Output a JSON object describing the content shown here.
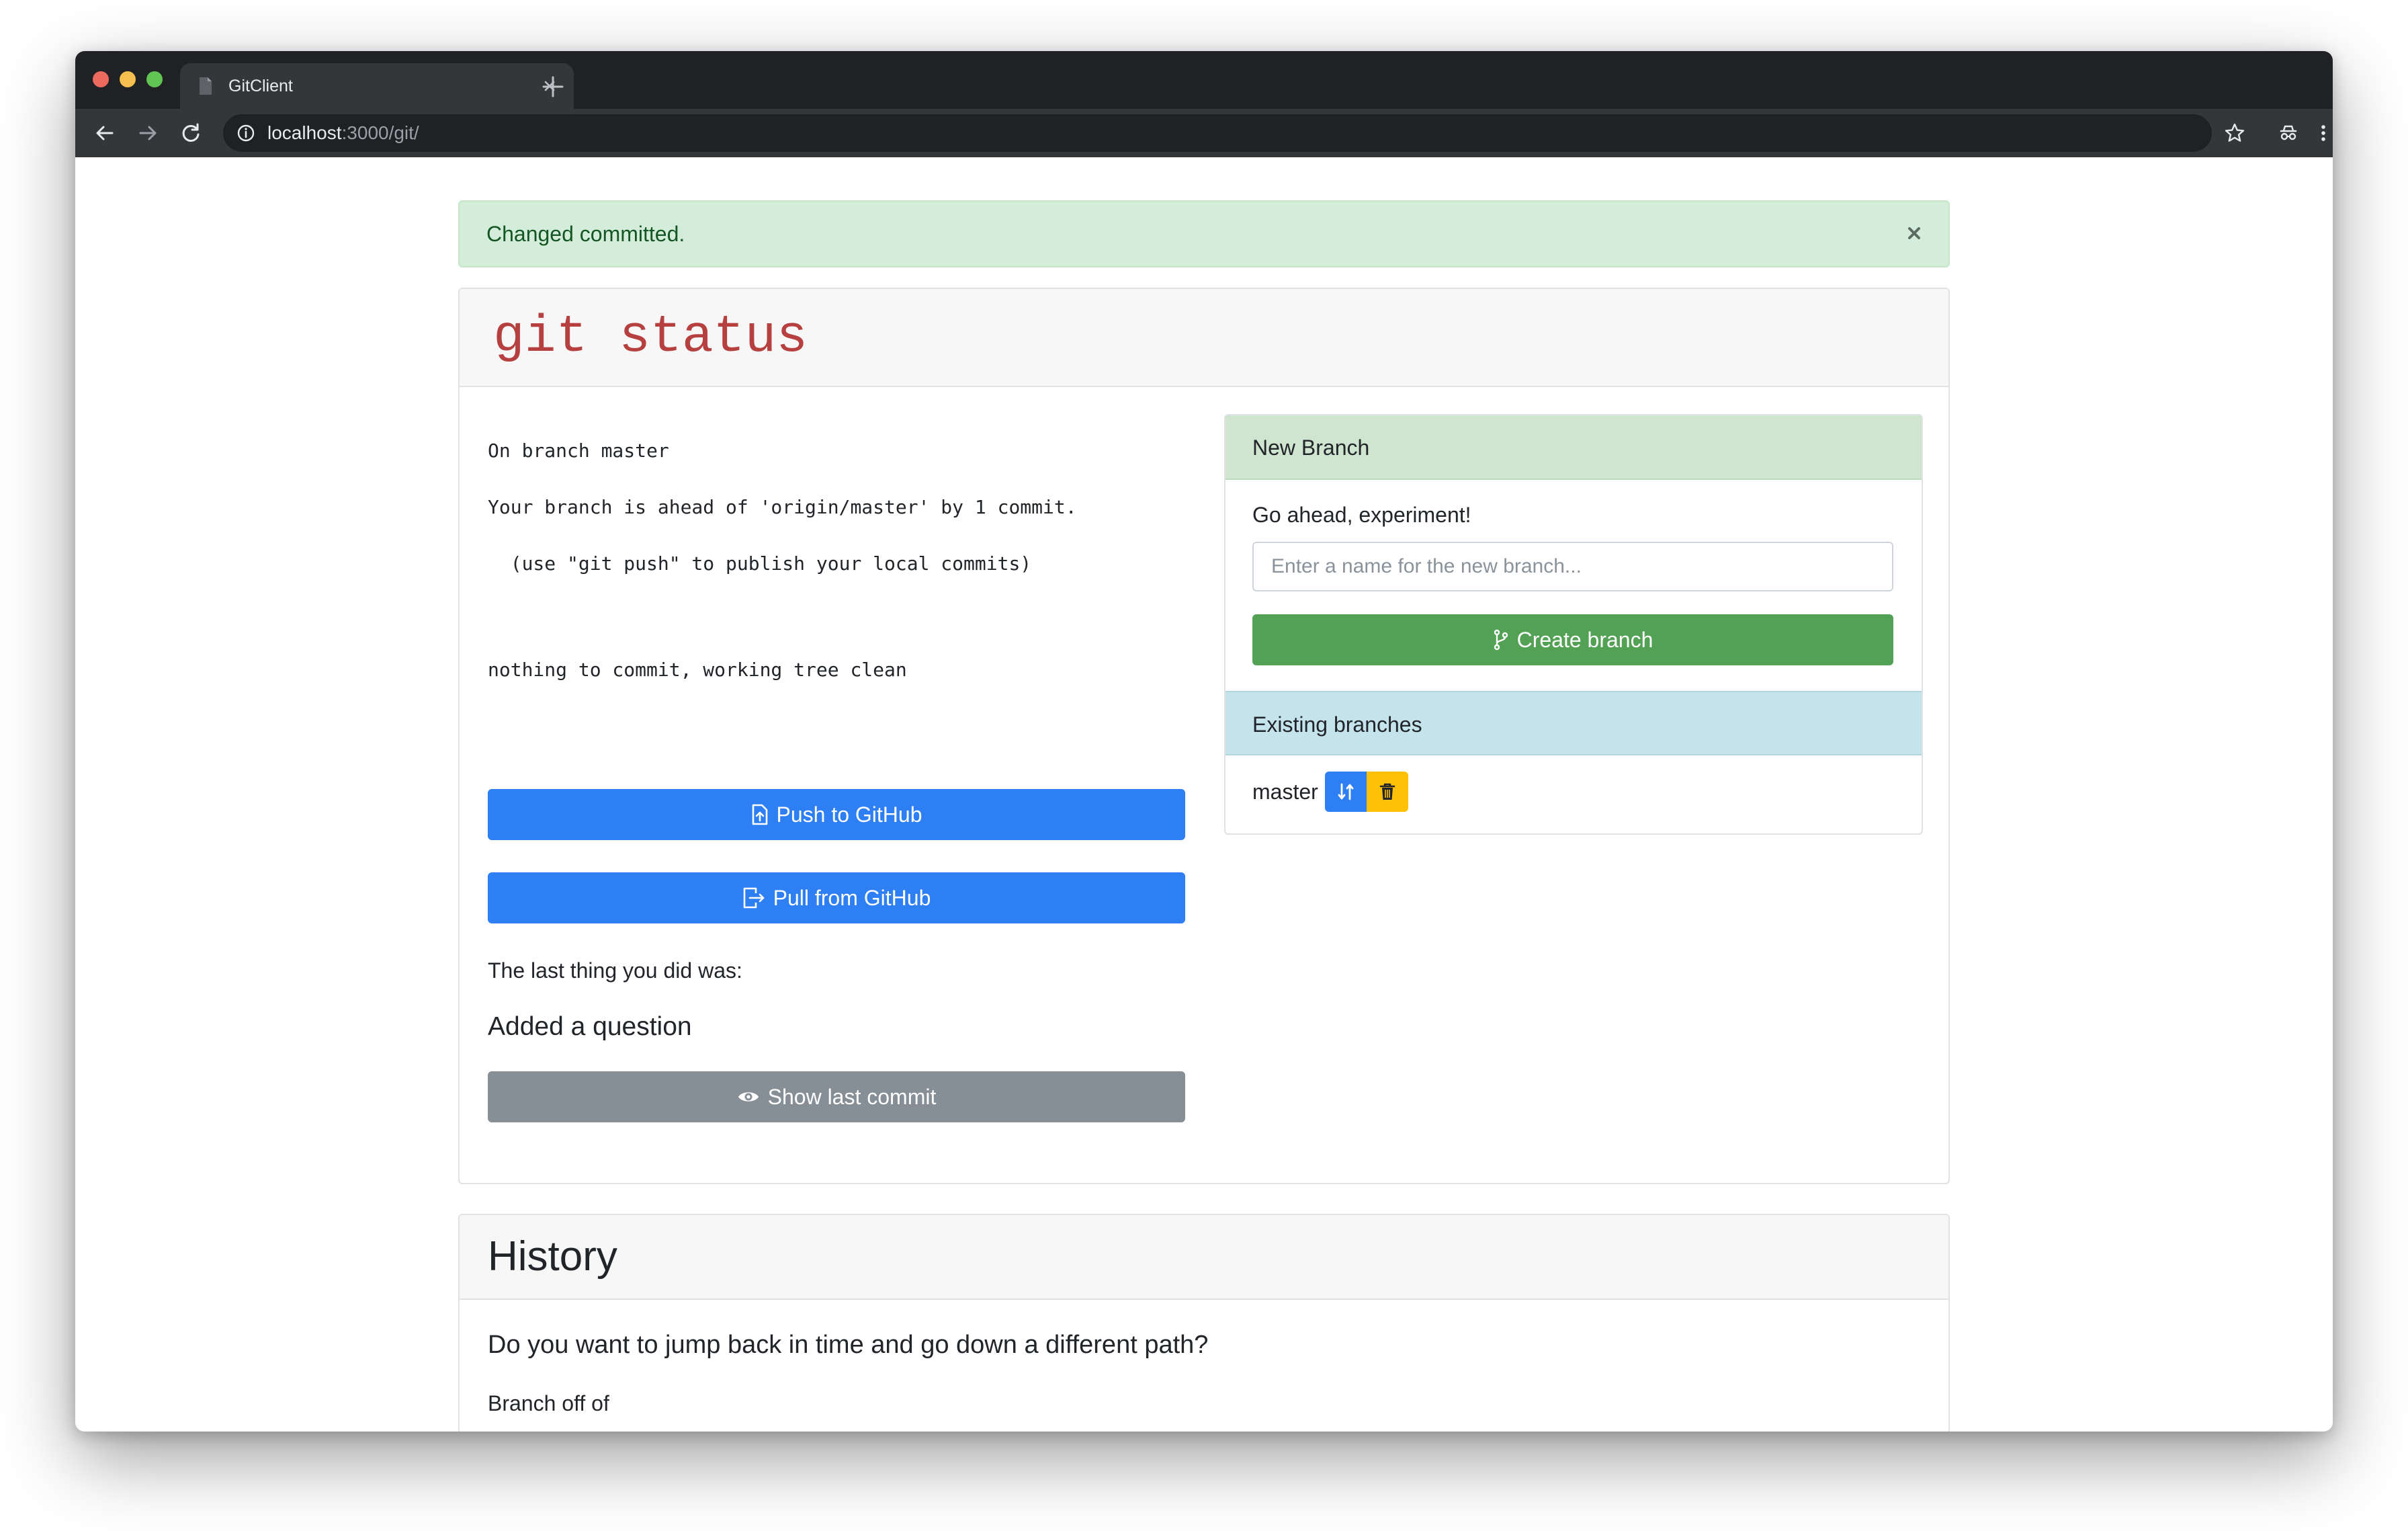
{
  "browser": {
    "tab_title": "GitClient",
    "url_host": "localhost",
    "url_path": ":3000/git/"
  },
  "alert": {
    "message": "Changed committed."
  },
  "status_card": {
    "title": "git status",
    "output": [
      "On branch master",
      "Your branch is ahead of 'origin/master' by 1 commit.",
      "  (use \"git push\" to publish your local commits)",
      "nothing to commit, working tree clean"
    ],
    "push_label": "Push to GitHub",
    "pull_label": "Pull from GitHub",
    "last_thing_label": "The last thing you did was:",
    "last_commit_message": "Added a question",
    "show_last_commit_label": "Show last commit"
  },
  "new_branch": {
    "header": "New Branch",
    "prompt": "Go ahead, experiment!",
    "input_placeholder": "Enter a name for the new branch...",
    "create_label": "Create branch"
  },
  "existing_branches": {
    "header": "Existing branches",
    "branches": [
      {
        "name": "master"
      }
    ]
  },
  "history": {
    "title": "History",
    "question": "Do you want to jump back in time and go down a different path?",
    "branch_off_label": "Branch off of"
  },
  "colors": {
    "primary": "#2d7ff3",
    "success": "#52a154",
    "warning": "#ffc107",
    "secondary": "#868e96",
    "alert_bg": "#d4edda",
    "title_red": "#b5403f"
  },
  "icons": {
    "push": "file-upload-icon",
    "pull": "file-export-icon",
    "show": "eye-icon",
    "branch": "code-branch-icon",
    "checkout": "sync-icon",
    "delete": "trash-icon"
  }
}
